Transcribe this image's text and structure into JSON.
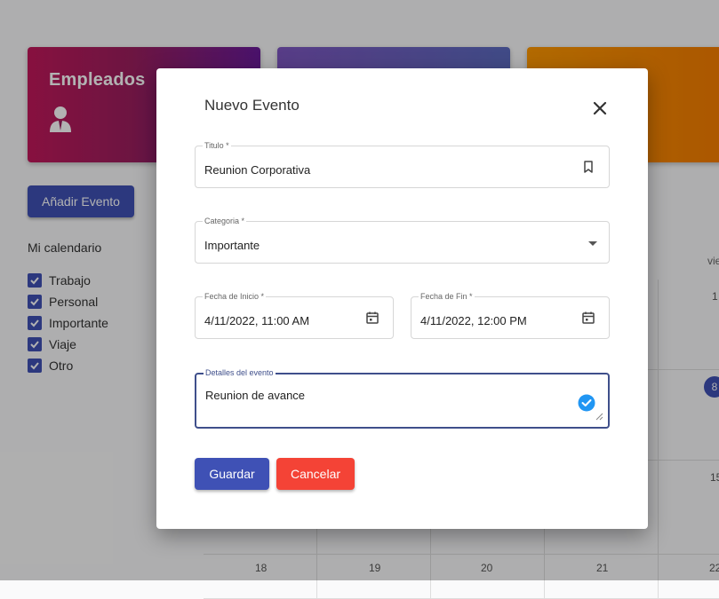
{
  "background": {
    "cards": [
      {
        "title": "Empleados",
        "icon": "user-tie-icon"
      },
      {
        "title": "",
        "icon": ""
      },
      {
        "title": "",
        "icon": ""
      }
    ],
    "add_event_label": "Añadir Evento",
    "my_calendar_title": "Mi calendario",
    "calendars": [
      {
        "label": "Trabajo",
        "checked": true
      },
      {
        "label": "Personal",
        "checked": true
      },
      {
        "label": "Importante",
        "checked": true
      },
      {
        "label": "Viaje",
        "checked": true
      },
      {
        "label": "Otro",
        "checked": true
      }
    ],
    "weekday_partial": "vie",
    "day_numbers": {
      "d1": "1",
      "d8": "8",
      "d15": "15",
      "d18": "18",
      "d19": "19",
      "d20": "20",
      "d21": "21",
      "d22": "22"
    },
    "colors": {
      "primary": "#3f51b5",
      "danger": "#f44336"
    }
  },
  "dialog": {
    "title": "Nuevo Evento",
    "close_icon": "close-icon",
    "fields": {
      "title": {
        "label": "Titulo *",
        "value": "Reunion Corporativa",
        "icon": "bookmark-icon"
      },
      "category": {
        "label": "Categoria *",
        "value": "Importante",
        "icon": "dropdown-arrow-icon"
      },
      "start": {
        "label": "Fecha de Inicio *",
        "value": "4/11/2022, 11:00 AM",
        "icon": "calendar-icon"
      },
      "end": {
        "label": "Fecha de Fin *",
        "value": "4/11/2022, 12:00 PM",
        "icon": "calendar-icon"
      },
      "details": {
        "label": "Detalles del evento",
        "value": "Reunion de avance",
        "icon": "check-circle-icon"
      }
    },
    "save_label": "Guardar",
    "cancel_label": "Cancelar"
  }
}
